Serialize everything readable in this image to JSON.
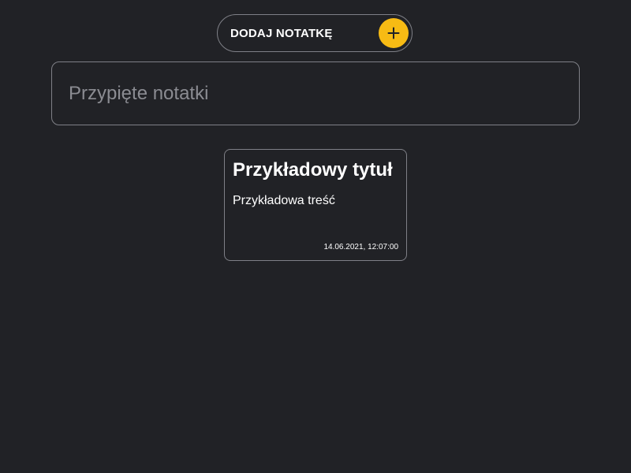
{
  "header": {
    "add_note_label": "DODAJ NOTATKĘ",
    "add_icon": "plus-icon"
  },
  "pinned": {
    "title": "Przypięte notatki"
  },
  "notes": [
    {
      "title": "Przykładowy tytuł",
      "content": "Przykładowa treść",
      "date": "14.06.2021, 12:07:00"
    }
  ],
  "colors": {
    "background": "#212226",
    "accent": "#f7bb14",
    "border": "#7f8087",
    "muted_text": "#8b8c92",
    "text": "#ffffff"
  }
}
